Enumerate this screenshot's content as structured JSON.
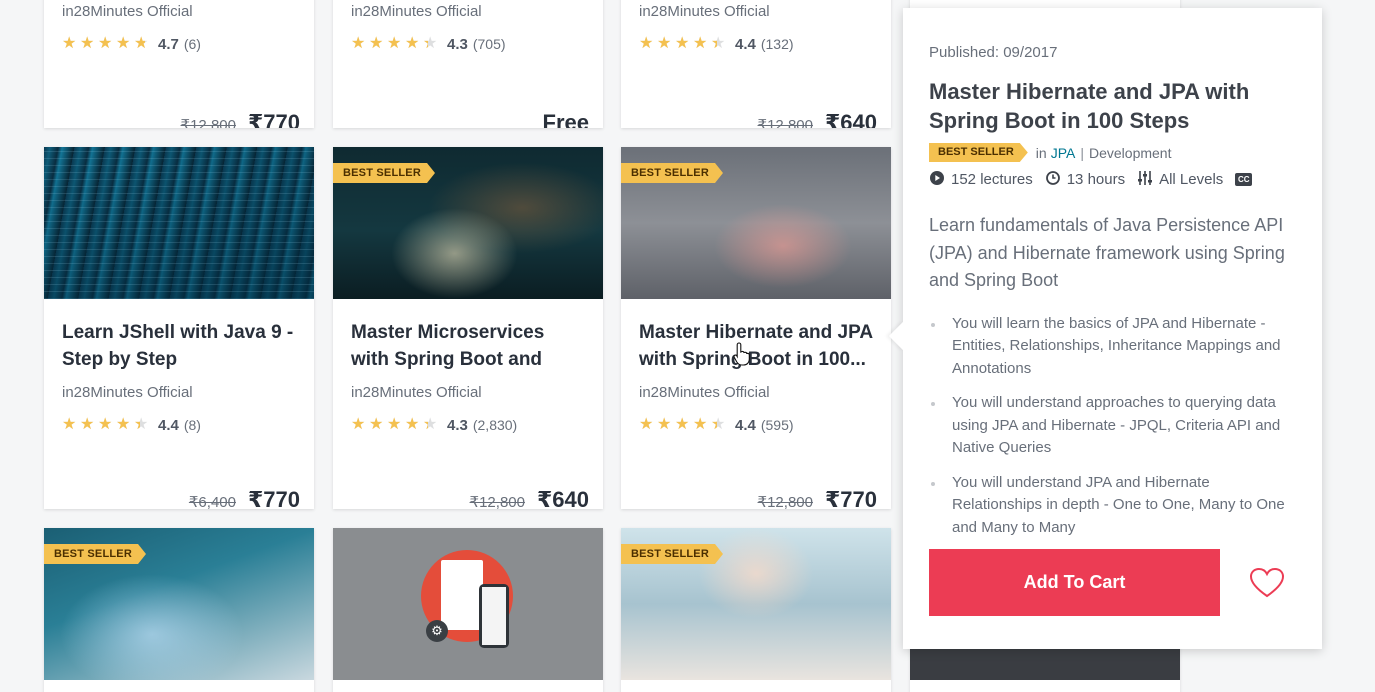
{
  "colors": {
    "accent": "#ec3c54",
    "star": "#f4c150",
    "badge": "#f4c150",
    "link": "#007791"
  },
  "row1": [
    {
      "instructor": "in28Minutes Official",
      "rating": "4.7",
      "rating_value": 4.7,
      "count": "(6)",
      "old_price": "₹12,800",
      "price": "₹770"
    },
    {
      "instructor": "in28Minutes Official",
      "rating": "4.3",
      "rating_value": 4.3,
      "count": "(705)",
      "old_price": "",
      "price": "Free"
    },
    {
      "instructor": "in28Minutes Official",
      "rating": "4.4",
      "rating_value": 4.4,
      "count": "(132)",
      "old_price": "₹12,800",
      "price": "₹640"
    }
  ],
  "row2": [
    {
      "badge": "",
      "title": "Learn JShell with Java 9 - Step by Step",
      "instructor": "in28Minutes Official",
      "rating": "4.4",
      "rating_value": 4.4,
      "count": "(8)",
      "old_price": "₹6,400",
      "price": "₹770"
    },
    {
      "badge": "BEST SELLER",
      "title": "Master Microservices with Spring Boot and Spring...",
      "instructor": "in28Minutes Official",
      "rating": "4.3",
      "rating_value": 4.3,
      "count": "(2,830)",
      "old_price": "₹12,800",
      "price": "₹640"
    },
    {
      "badge": "BEST SELLER",
      "title": "Master Hibernate and JPA with Spring Boot in 100...",
      "instructor": "in28Minutes Official",
      "rating": "4.4",
      "rating_value": 4.4,
      "count": "(595)",
      "old_price": "₹12,800",
      "price": "₹770"
    }
  ],
  "row3": [
    {
      "badge": "BEST SELLER"
    },
    {
      "badge": ""
    },
    {
      "badge": "BEST SELLER"
    }
  ],
  "popover": {
    "published": "Published: 09/2017",
    "title": "Master Hibernate and JPA with Spring Boot in 100 Steps",
    "badge": "BEST SELLER",
    "in_label": "in",
    "category": "JPA",
    "separator": "|",
    "subcategory": "Development",
    "lectures": "152 lectures",
    "hours": "13 hours",
    "level": "All Levels",
    "cc": "CC",
    "description": "Learn fundamentals of Java Persistence API (JPA) and Hibernate framework using Spring and Spring Boot",
    "bullets": [
      "You will learn the basics of JPA and Hibernate - Entities, Relationships, Inheritance Mappings and Annotations",
      "You will understand approaches to querying data using JPA and Hibernate - JPQL, Criteria API and Native Queries",
      "You will understand JPA and Hibernate Relationships in depth - One to One, Many to One and Many to Many"
    ],
    "add_to_cart": "Add To Cart"
  }
}
